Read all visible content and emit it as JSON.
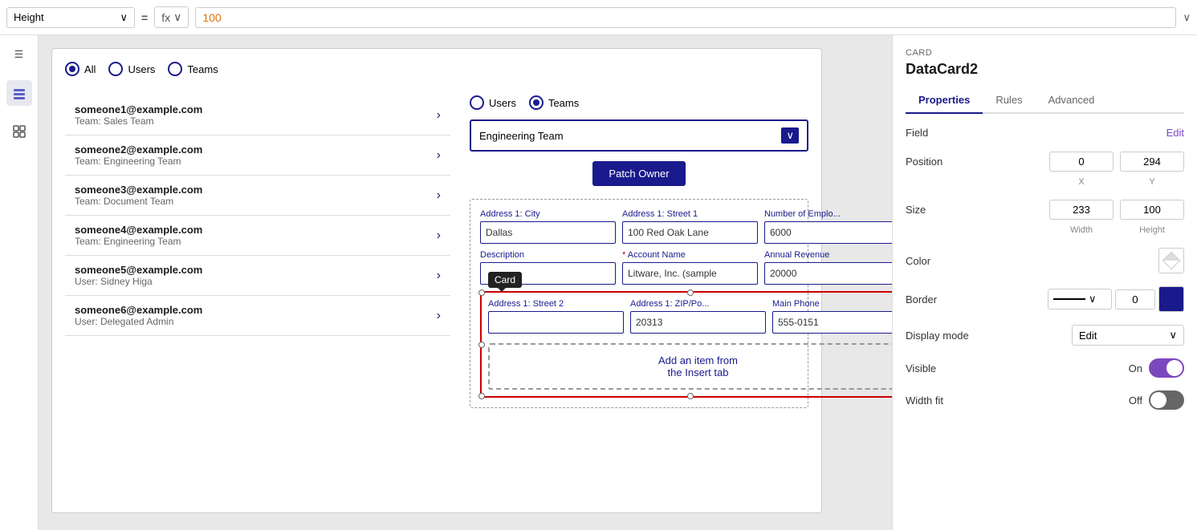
{
  "formula_bar": {
    "property_label": "Height",
    "equals_sign": "=",
    "fx_label": "fx",
    "formula_value": "100",
    "dropdown_arrow": "∨"
  },
  "sidebar": {
    "icons": [
      {
        "name": "hamburger-icon",
        "symbol": "☰"
      },
      {
        "name": "layers-icon",
        "symbol": "⊞"
      },
      {
        "name": "grid-icon",
        "symbol": "⊟"
      }
    ]
  },
  "canvas": {
    "radio_group": {
      "options": [
        "All",
        "Users",
        "Teams"
      ],
      "selected": "All"
    },
    "users": [
      {
        "email": "someone1@example.com",
        "team": "Team: Sales Team"
      },
      {
        "email": "someone2@example.com",
        "team": "Team: Engineering Team"
      },
      {
        "email": "someone3@example.com",
        "team": "Team: Document Team"
      },
      {
        "email": "someone4@example.com",
        "team": "Team: Engineering Team"
      },
      {
        "email": "someone5@example.com",
        "team": "User: Sidney Higa"
      },
      {
        "email": "someone6@example.com",
        "team": "User: Delegated Admin"
      }
    ],
    "right_panel": {
      "teams_radio": {
        "options": [
          "Users",
          "Teams"
        ],
        "selected": "Teams"
      },
      "dropdown_value": "Engineering Team",
      "patch_button": "Patch Owner",
      "fields": [
        {
          "label": "Address 1: City",
          "value": "Dallas",
          "required": false
        },
        {
          "label": "Address 1: Street 1",
          "value": "100 Red Oak Lane",
          "required": false
        },
        {
          "label": "Number of Emplo...",
          "value": "6000",
          "required": false
        },
        {
          "label": "Description",
          "value": "",
          "required": false
        },
        {
          "label": "Account Name",
          "value": "Litware, Inc. (sample",
          "required": true
        },
        {
          "label": "Annual Revenue",
          "value": "20000",
          "required": false
        },
        {
          "label": "Address 1: Street 2",
          "value": "",
          "required": false
        },
        {
          "label": "Address 1: ZIP/Po...",
          "value": "20313",
          "required": false
        },
        {
          "label": "Main Phone",
          "value": "555-0151",
          "required": false
        }
      ],
      "card_tooltip": "Card",
      "add_item_text": "Add an item from\nthe Insert tab"
    }
  },
  "properties_panel": {
    "card_label": "CARD",
    "title": "DataCard2",
    "tabs": [
      "Properties",
      "Rules",
      "Advanced"
    ],
    "active_tab": "Properties",
    "field_label": "Field",
    "edit_label": "Edit",
    "position_label": "Position",
    "position_x": "0",
    "position_y": "294",
    "x_label": "X",
    "y_label": "Y",
    "size_label": "Size",
    "size_width": "233",
    "size_height": "100",
    "width_label": "Width",
    "height_label": "Height",
    "color_label": "Color",
    "border_label": "Border",
    "border_width": "0",
    "display_mode_label": "Display mode",
    "display_mode_value": "Edit",
    "visible_label": "Visible",
    "visible_on": "On",
    "width_fit_label": "Width fit",
    "width_fit_off": "Off"
  }
}
